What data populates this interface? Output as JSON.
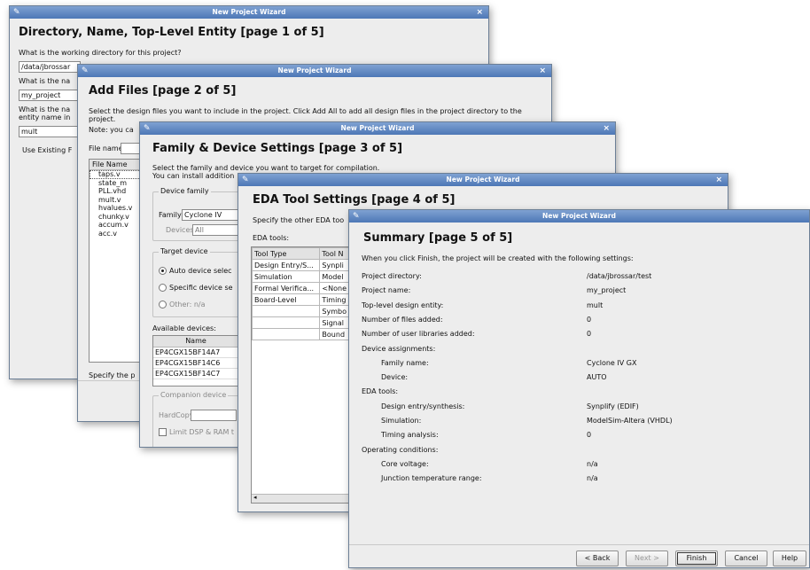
{
  "title": "New Project Wizard",
  "close_glyph": "×",
  "w1": {
    "heading": "Directory, Name, Top-Level Entity [page 1 of 5]",
    "q_dir": "What is the working directory for this project?",
    "dir_value": "/data/jbrossar",
    "q_name": "What is the na",
    "name_value": "my_project",
    "q_entity_1": "What is the na",
    "q_entity_2": "entity name in",
    "entity_value": "mult",
    "use_existing": "Use Existing F"
  },
  "w2": {
    "heading": "Add Files [page 2 of 5]",
    "desc_1": "Select the design files you want to include in the project. Click Add All to add all design files in the project directory to the",
    "desc_2": "project.",
    "note": "Note: you ca",
    "file_name_label": "File name:",
    "list_header": "File Name",
    "files": [
      "taps.v",
      "state_m",
      "PLL.vhd",
      "mult.v",
      "hvalues.v",
      "chunky.v",
      "accum.v",
      "acc.v"
    ],
    "specify": "Specify the p"
  },
  "w3": {
    "heading": "Family & Device Settings [page 3 of 5]",
    "desc_1": "Select the family and device you want to target for compilation.",
    "desc_2": "You can install addition",
    "device_family_label": "Device family",
    "family_label": "Family:",
    "family_value": "Cyclone IV",
    "devices_label": "Devices:",
    "devices_value": "All",
    "target_device_label": "Target device",
    "auto_label": "Auto device selec",
    "specific_label": "Specific device se",
    "other_label": "Other:  n/a",
    "available_label": "Available devices:",
    "col_name": "Name",
    "devices": [
      "EP4CGX15BF14A7",
      "EP4CGX15BF14C6",
      "EP4CGX15BF14C7"
    ],
    "companion_label": "Companion device",
    "hardcopy_label": "HardCopy:",
    "limit_label": "Limit DSP & RAM t"
  },
  "w4": {
    "heading": "EDA Tool Settings [page 4 of 5]",
    "desc": "Specify the other EDA too",
    "eda_label": "EDA tools:",
    "col_type": "Tool Type",
    "col_name": "Tool N",
    "rows": [
      [
        "Design Entry/S...",
        "Synpli"
      ],
      [
        "Simulation",
        "Model"
      ],
      [
        "Formal Verifica...",
        "<None"
      ],
      [
        "Board-Level",
        "Timing"
      ],
      [
        "",
        "Symbo"
      ],
      [
        "",
        "Signal"
      ],
      [
        "",
        "Bound"
      ]
    ]
  },
  "w5": {
    "heading": "Summary [page 5 of 5]",
    "desc": "When you click Finish, the project will be created with the following settings:",
    "rows": [
      {
        "label": "Project directory:",
        "value": "/data/jbrossar/test",
        "indent": 0
      },
      {
        "label": "Project name:",
        "value": "my_project",
        "indent": 0
      },
      {
        "label": "Top-level design entity:",
        "value": "mult",
        "indent": 0
      },
      {
        "label": "Number of files added:",
        "value": "0",
        "indent": 0
      },
      {
        "label": "Number of user libraries added:",
        "value": "0",
        "indent": 0
      },
      {
        "label": "Device assignments:",
        "value": "",
        "indent": 0
      },
      {
        "label": "Family name:",
        "value": "Cyclone IV GX",
        "indent": 1
      },
      {
        "label": "Device:",
        "value": "AUTO",
        "indent": 1
      },
      {
        "label": "EDA tools:",
        "value": "",
        "indent": 0
      },
      {
        "label": "Design entry/synthesis:",
        "value": "Synplify (EDIF)",
        "indent": 1
      },
      {
        "label": "Simulation:",
        "value": "ModelSim-Altera (VHDL)",
        "indent": 1
      },
      {
        "label": "Timing analysis:",
        "value": "0",
        "indent": 1
      },
      {
        "label": "Operating conditions:",
        "value": "",
        "indent": 0
      },
      {
        "label": "Core voltage:",
        "value": "n/a",
        "indent": 1
      },
      {
        "label": "Junction temperature range:",
        "value": "n/a",
        "indent": 1
      }
    ],
    "buttons": {
      "back": "< Back",
      "next": "Next >",
      "finish": "Finish",
      "cancel": "Cancel",
      "help": "Help"
    }
  }
}
